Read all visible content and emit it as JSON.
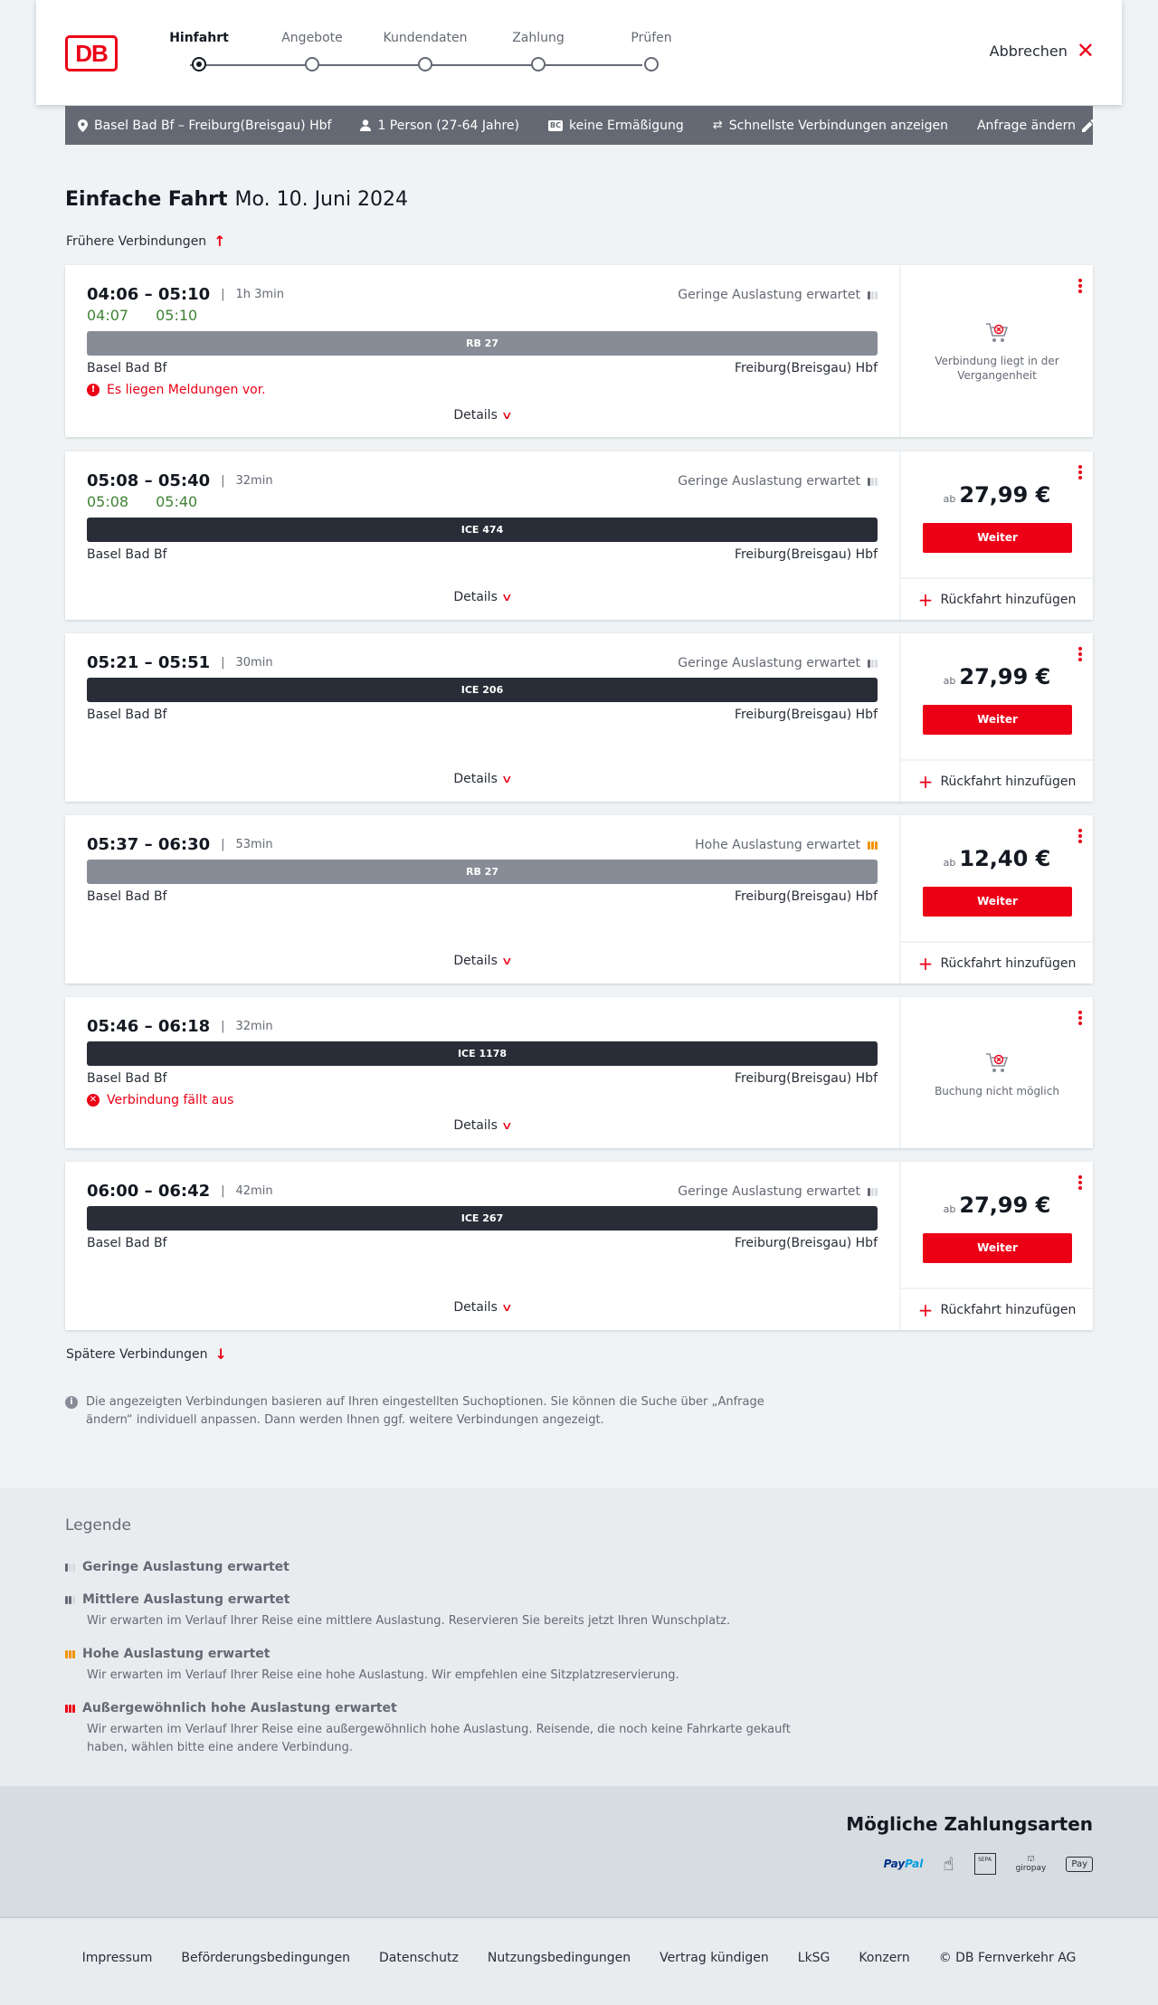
{
  "header": {
    "logo": "DB",
    "steps": [
      {
        "label": "Hinfahrt",
        "active": true
      },
      {
        "label": "Angebote",
        "active": false
      },
      {
        "label": "Kundendaten",
        "active": false
      },
      {
        "label": "Zahlung",
        "active": false
      },
      {
        "label": "Prüfen",
        "active": false
      }
    ],
    "cancel": "Abbrechen"
  },
  "search": {
    "route": "Basel Bad Bf – Freiburg(Breisgau) Hbf",
    "persons": "1 Person (27-64 Jahre)",
    "discount_badge": "BC",
    "discount": "keine Ermäßigung",
    "fastest": "Schnellste Verbindungen anzeigen",
    "change": "Anfrage ändern"
  },
  "title": {
    "type": "Einfache Fahrt",
    "date": "Mo. 10. Juni 2024"
  },
  "earlier": "Frühere Verbindungen",
  "later": "Spätere Verbindungen",
  "labels": {
    "details": "Details",
    "ab": "ab",
    "weiter": "Weiter",
    "return": "Rückfahrt hinzufügen"
  },
  "connections": [
    {
      "times": "04:06 – 05:10",
      "duration": "1h 3min",
      "realtime": [
        "04:07",
        "05:10"
      ],
      "load": "Geringe Auslastung erwartet",
      "load_level": "low",
      "train": "RB 27",
      "train_type": "rb",
      "from": "Basel Bad Bf",
      "to": "Freiburg(Breisgau) Hbf",
      "message": "Es liegen Meldungen vor.",
      "unavailable": "Verbindung liegt in der Vergangenheit"
    },
    {
      "times": "05:08 – 05:40",
      "duration": "32min",
      "realtime": [
        "05:08",
        "05:40"
      ],
      "load": "Geringe Auslastung erwartet",
      "load_level": "low",
      "train": "ICE 474",
      "train_type": "ice",
      "from": "Basel Bad Bf",
      "to": "Freiburg(Breisgau) Hbf",
      "price": "27,99 €"
    },
    {
      "times": "05:21 – 05:51",
      "duration": "30min",
      "load": "Geringe Auslastung erwartet",
      "load_level": "low",
      "train": "ICE 206",
      "train_type": "ice",
      "from": "Basel Bad Bf",
      "to": "Freiburg(Breisgau) Hbf",
      "price": "27,99 €"
    },
    {
      "times": "05:37 – 06:30",
      "duration": "53min",
      "load": "Hohe Auslastung erwartet",
      "load_level": "high",
      "train": "RB 27",
      "train_type": "rb",
      "from": "Basel Bad Bf",
      "to": "Freiburg(Breisgau) Hbf",
      "price": "12,40 €"
    },
    {
      "times": "05:46 – 06:18",
      "duration": "32min",
      "train": "ICE 1178",
      "train_type": "ice",
      "from": "Basel Bad Bf",
      "to": "Freiburg(Breisgau) Hbf",
      "message": "Verbindung fällt aus",
      "unavailable": "Buchung nicht möglich"
    },
    {
      "times": "06:00 – 06:42",
      "duration": "42min",
      "load": "Geringe Auslastung erwartet",
      "load_level": "low",
      "train": "ICE 267",
      "train_type": "ice",
      "from": "Basel Bad Bf",
      "to": "Freiburg(Breisgau) Hbf",
      "price": "27,99 €"
    }
  ],
  "info": "Die angezeigten Verbindungen basieren auf Ihren eingestellten Suchoptionen. Sie können die Suche über „Anfrage ändern“ individuell anpassen. Dann werden Ihnen ggf. weitere Verbindungen angezeigt.",
  "legend": {
    "title": "Legende",
    "items": [
      {
        "title": "Geringe Auslastung erwartet",
        "desc": ""
      },
      {
        "title": "Mittlere Auslastung erwartet",
        "desc": "Wir erwarten im Verlauf Ihrer Reise eine mittlere Auslastung. Reservieren Sie bereits jetzt Ihren Wunschplatz."
      },
      {
        "title": "Hohe Auslastung erwartet",
        "desc": "Wir erwarten im Verlauf Ihrer Reise eine hohe Auslastung. Wir empfehlen eine Sitzplatzreservierung."
      },
      {
        "title": "Außergewöhnlich hohe Auslastung erwartet",
        "desc": "Wir erwarten im Verlauf Ihrer Reise eine außergewöhnlich hohe Auslastung. Reisende, die noch keine Fahrkarte gekauft haben, wählen bitte eine andere Verbindung."
      }
    ]
  },
  "payment": {
    "title": "Mögliche Zahlungsarten",
    "paypal": [
      "Pay",
      "Pal"
    ],
    "sepa": "SEPA",
    "giropay": "giropay",
    "applepay": "Pay"
  },
  "footer": [
    "Impressum",
    "Beförderungsbedingungen",
    "Datenschutz",
    "Nutzungsbedingungen",
    "Vertrag kündigen",
    "LkSG",
    "Konzern",
    "© DB Fernverkehr AG"
  ]
}
